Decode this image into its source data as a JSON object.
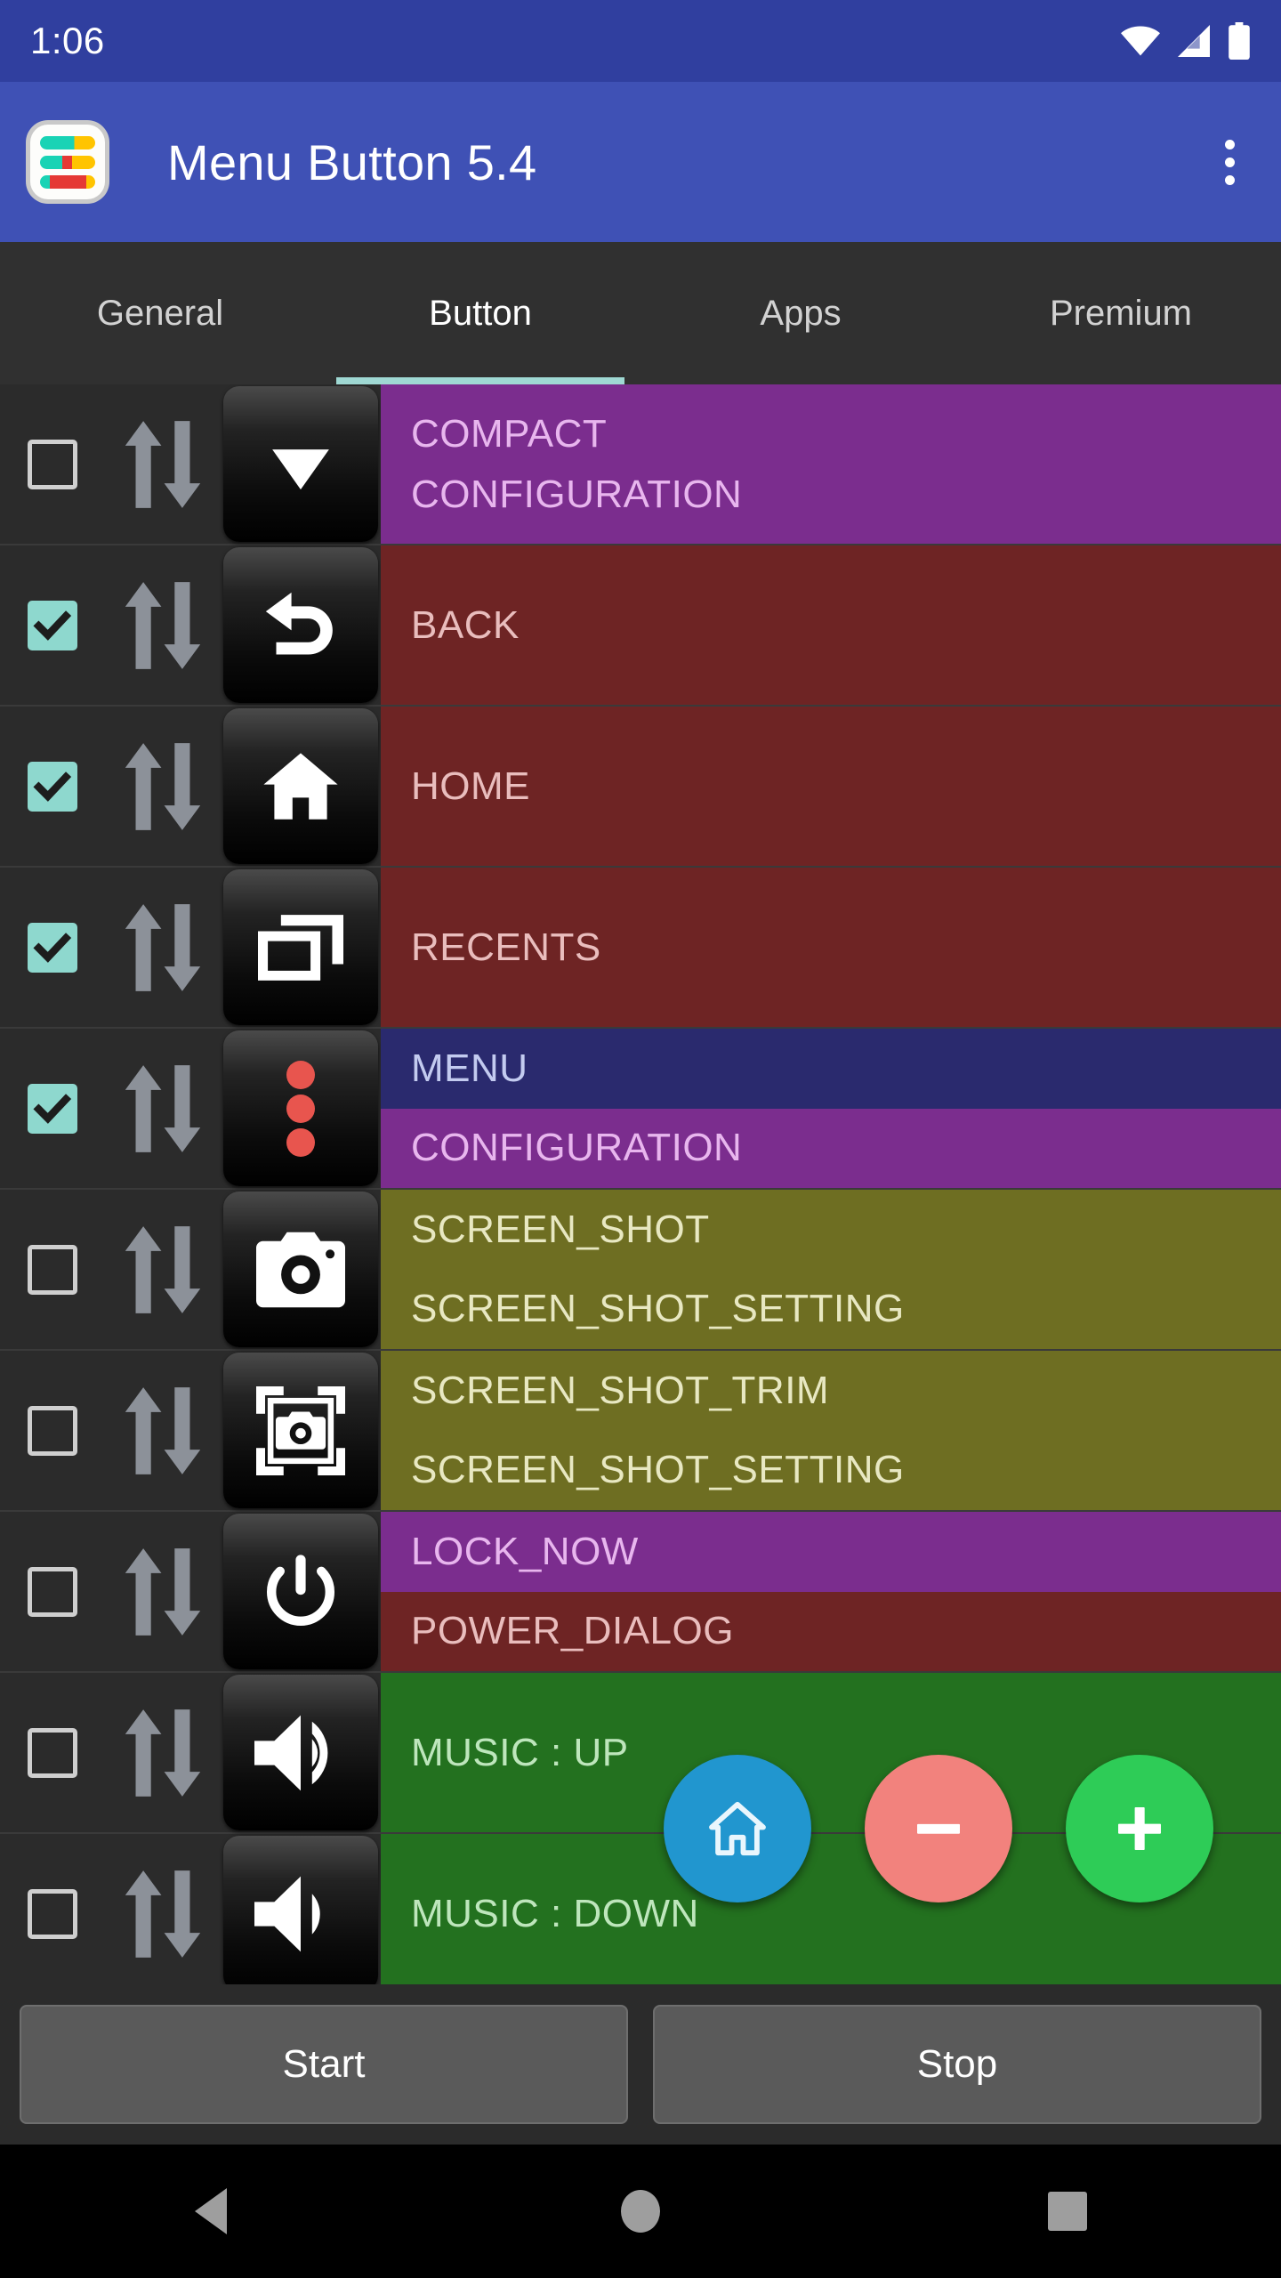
{
  "status_bar": {
    "time": "1:06",
    "icons": [
      "wifi-icon",
      "cell-signal-icon",
      "battery-icon"
    ]
  },
  "app_bar": {
    "title": "Menu Button 5.4",
    "logo_icon": "app-logo-icon",
    "overflow_icon": "overflow-menu-icon"
  },
  "tabs": [
    {
      "label": "General",
      "active": false
    },
    {
      "label": "Button",
      "active": true
    },
    {
      "label": "Apps",
      "active": false
    },
    {
      "label": "Premium",
      "active": false
    }
  ],
  "colors": {
    "accent": "#9fd8d3",
    "appbar": "#3F51B5",
    "statusbar": "#303F9F",
    "purple": "#7B2D8E",
    "dark_red": "#6E2424",
    "navy": "#2A2A6E",
    "olive": "#6E6E22",
    "green": "#23711F",
    "checkbox_on": "#8ed8ce",
    "fab_home": "#2196CF",
    "fab_minus": "#F2827D",
    "fab_plus": "#2ECC57"
  },
  "rows": [
    {
      "checked": false,
      "icon": "compact-triangle-icon",
      "sort_icon": "sort-updown-icon",
      "labels": [
        {
          "text": "COMPACT",
          "bg": "#7B2D8E",
          "fg": "#E8B6EE"
        },
        {
          "text": "CONFIGURATION",
          "bg": "#7B2D8E",
          "fg": "#E8B6EE"
        }
      ],
      "merged": true
    },
    {
      "checked": true,
      "icon": "back-arrow-icon",
      "sort_icon": "sort-updown-icon",
      "labels": [
        {
          "text": "BACK",
          "bg": "#6E2424",
          "fg": "#E9BDBD"
        }
      ]
    },
    {
      "checked": true,
      "icon": "home-icon",
      "sort_icon": "sort-updown-icon",
      "labels": [
        {
          "text": "HOME",
          "bg": "#6E2424",
          "fg": "#E9BDBD"
        }
      ]
    },
    {
      "checked": true,
      "icon": "recents-icon",
      "sort_icon": "sort-updown-icon",
      "labels": [
        {
          "text": "RECENTS",
          "bg": "#6E2424",
          "fg": "#E9BDBD"
        }
      ]
    },
    {
      "checked": true,
      "icon": "menu-dots-icon",
      "sort_icon": "sort-updown-icon",
      "labels": [
        {
          "text": "MENU",
          "bg": "#2A2A6E",
          "fg": "#C3CBF0"
        },
        {
          "text": "CONFIGURATION",
          "bg": "#7B2D8E",
          "fg": "#E8B6EE"
        }
      ]
    },
    {
      "checked": false,
      "icon": "camera-icon",
      "sort_icon": "sort-updown-icon",
      "labels": [
        {
          "text": "SCREEN_SHOT",
          "bg": "#6E6E22",
          "fg": "#E8E8C2"
        },
        {
          "text": "SCREEN_SHOT_SETTING",
          "bg": "#6E6E22",
          "fg": "#E8E8C2"
        }
      ]
    },
    {
      "checked": false,
      "icon": "camera-crop-icon",
      "sort_icon": "sort-updown-icon",
      "labels": [
        {
          "text": "SCREEN_SHOT_TRIM",
          "bg": "#6E6E22",
          "fg": "#E8E8C2"
        },
        {
          "text": "SCREEN_SHOT_SETTING",
          "bg": "#6E6E22",
          "fg": "#E8E8C2"
        }
      ]
    },
    {
      "checked": false,
      "icon": "power-icon",
      "sort_icon": "sort-updown-icon",
      "labels": [
        {
          "text": "LOCK_NOW",
          "bg": "#7B2D8E",
          "fg": "#E8B6EE"
        },
        {
          "text": "POWER_DIALOG",
          "bg": "#6E2424",
          "fg": "#E9BDBD"
        }
      ]
    },
    {
      "checked": false,
      "icon": "volume-up-icon",
      "sort_icon": "sort-updown-icon",
      "labels": [
        {
          "text": "MUSIC : UP",
          "bg": "#23711F",
          "fg": "#BEE6BC"
        }
      ]
    },
    {
      "checked": false,
      "icon": "volume-down-icon",
      "sort_icon": "sort-updown-icon",
      "labels": [
        {
          "text": "MUSIC : DOWN",
          "bg": "#23711F",
          "fg": "#BEE6BC"
        }
      ]
    }
  ],
  "floating_buttons": [
    {
      "name": "fab-home",
      "icon": "home-outline-icon",
      "color": "#2196CF"
    },
    {
      "name": "fab-minus",
      "icon": "minus-icon",
      "color": "#F2827D"
    },
    {
      "name": "fab-plus",
      "icon": "plus-icon",
      "color": "#2ECC57"
    }
  ],
  "bottom_buttons": {
    "start_label": "Start",
    "stop_label": "Stop"
  },
  "nav_bar": {
    "back_icon": "nav-back-icon",
    "home_icon": "nav-home-icon",
    "recents_icon": "nav-recents-icon"
  }
}
